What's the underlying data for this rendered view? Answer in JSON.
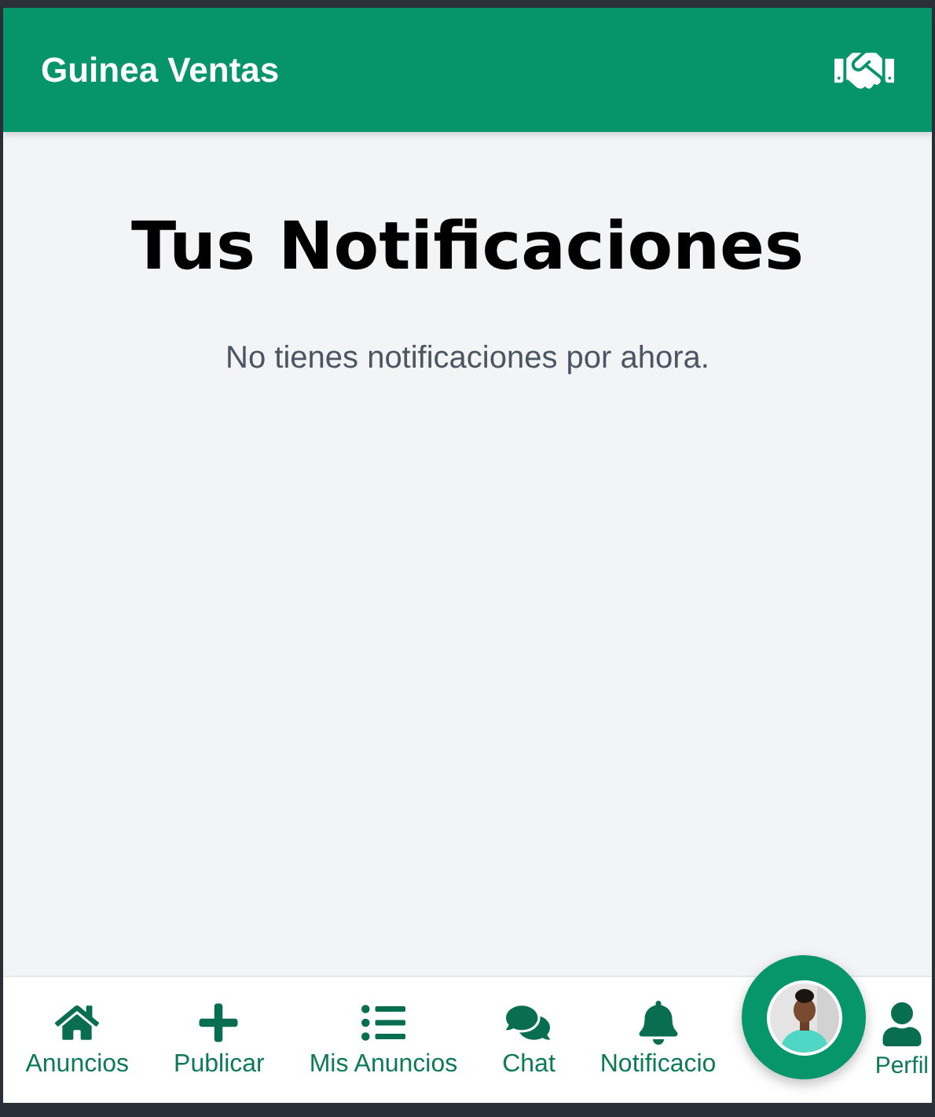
{
  "header": {
    "title": "Guinea Ventas"
  },
  "page": {
    "title": "Tus Notificaciones",
    "empty_message": "No tienes notificaciones por ahora."
  },
  "bottom_nav": [
    {
      "kind": "home",
      "label": "Anuncios"
    },
    {
      "kind": "add",
      "label": "Publicar"
    },
    {
      "kind": "list",
      "label": "Mis Anuncios"
    },
    {
      "kind": "chat",
      "label": "Chat"
    },
    {
      "kind": "bell",
      "label": "Notificacio"
    },
    {
      "kind": "user",
      "label": "Perfil"
    }
  ]
}
